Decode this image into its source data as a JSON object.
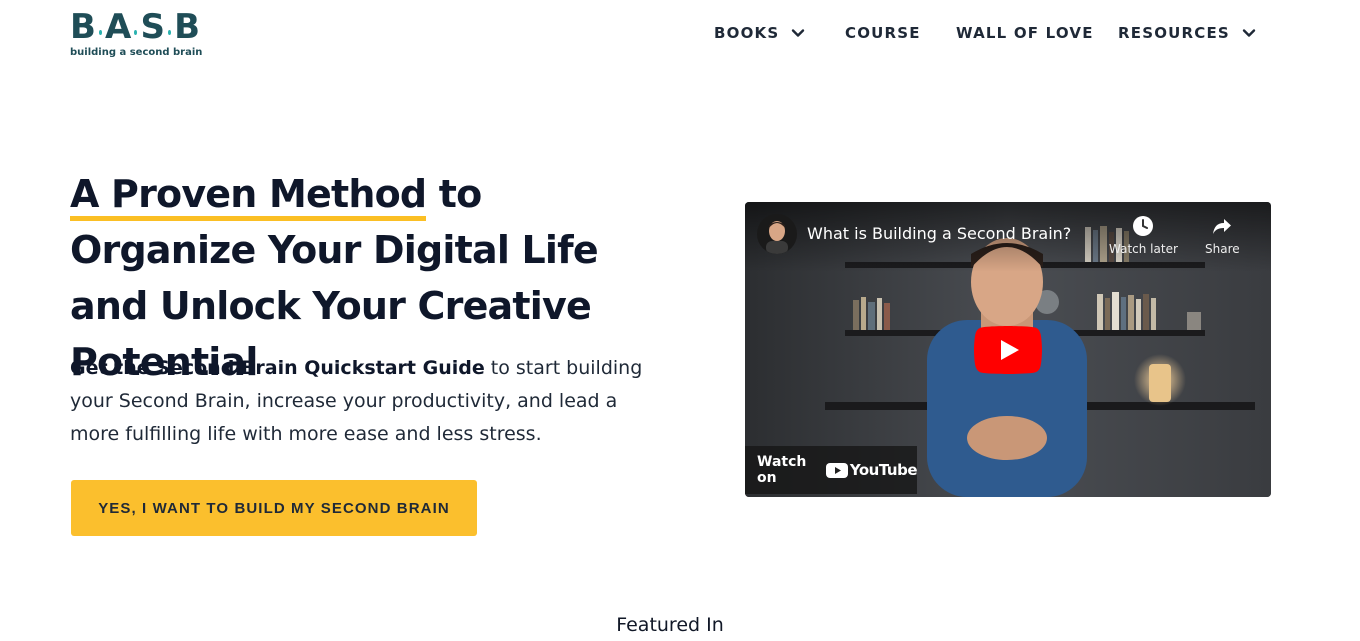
{
  "logo": {
    "letters": [
      "B",
      "A",
      "S",
      "B"
    ],
    "tagline": "building a second brain",
    "color": "#1f4d57",
    "dot_color": "#2bb3b0"
  },
  "nav": {
    "items": [
      {
        "label": "BOOKS",
        "has_dropdown": true
      },
      {
        "label": "COURSE",
        "has_dropdown": false
      },
      {
        "label": "WALL OF LOVE",
        "has_dropdown": false
      },
      {
        "label": "RESOURCES",
        "has_dropdown": true
      }
    ]
  },
  "hero": {
    "title_highlight": "A Proven Method",
    "title_rest": " to Organize Your Digital Life and Unlock Your Creative Potential",
    "subtitle_bold": "Get the Second Brain Quickstart Guide",
    "subtitle_rest": " to start building your Second Brain, increase your productivity, and lead a more fulfilling life with more ease and less stress.",
    "cta_label": "YES, I WANT TO BUILD MY SECOND BRAIN",
    "highlight_color": "#fbbf24",
    "cta_color": "#fbbf2d"
  },
  "video": {
    "title": "What is Building a Second Brain?",
    "watch_later_label": "Watch later",
    "share_label": "Share",
    "watch_on_label": "Watch on",
    "platform_label": "YouTube",
    "play_color": "#ff0000"
  },
  "featured": {
    "label": "Featured In"
  }
}
